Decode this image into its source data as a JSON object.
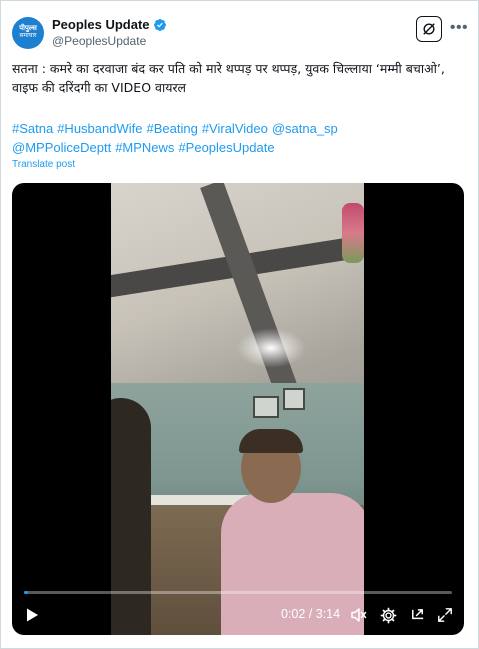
{
  "account": {
    "display_name": "Peoples Update",
    "handle": "@PeoplesUpdate",
    "avatar_text_top": "पीपुल्स",
    "avatar_text_bottom": "समाचार"
  },
  "post": {
    "text": "सतना : कमरे का दरवाजा बंद कर पति को मारे थप्पड़ पर थप्पड़, युवक चिल्लाया ‘मम्मी बचाओ’, वाइफ की दरिंदगी का VIDEO वायरल",
    "hashtags_line1": [
      "#Satna",
      "#HusbandWife",
      "#Beating",
      "#ViralVideo",
      "@satna_sp"
    ],
    "hashtags_line2": [
      "@MPPoliceDeptt",
      "#MPNews",
      "#PeoplesUpdate"
    ],
    "translate_label": "Translate post"
  },
  "video": {
    "current_time": "0:02",
    "duration": "3:14",
    "time_display": "0:02 / 3:14",
    "progress_fraction": 0.01
  },
  "colors": {
    "accent": "#1d9bf0",
    "text": "#0f1419",
    "muted": "#536471"
  }
}
